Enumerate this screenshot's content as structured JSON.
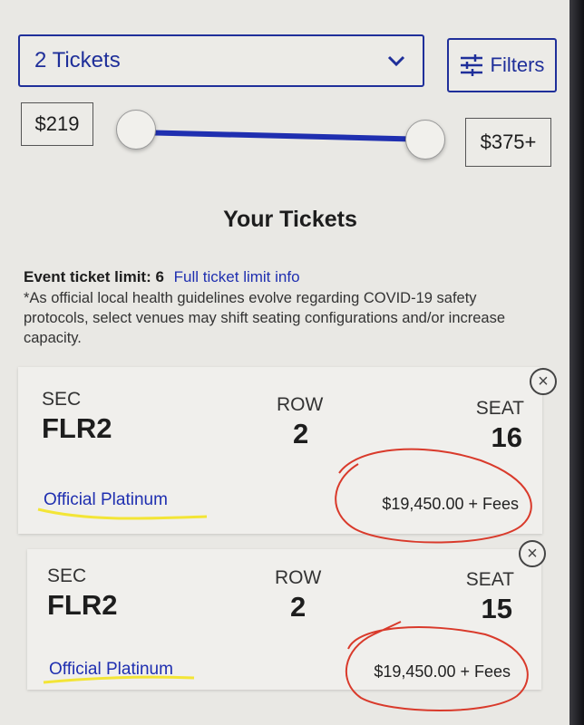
{
  "quantity": {
    "selected": "2 Tickets"
  },
  "filters": {
    "label": "Filters"
  },
  "price_range": {
    "min_label": "$219",
    "max_label": "$375+"
  },
  "section": {
    "title": "Your Tickets"
  },
  "limit": {
    "label": "Event ticket limit: 6",
    "link": "Full ticket limit info",
    "disclaimer": "*As official local health guidelines evolve regarding COVID-19 safety protocols, select venues may shift seating configurations and/or increase capacity."
  },
  "tickets": [
    {
      "sec_label": "SEC",
      "sec": "FLR2",
      "row_label": "ROW",
      "row": "2",
      "seat_label": "SEAT",
      "seat": "16",
      "tier": "Official Platinum",
      "price": "$19,450.00 + Fees"
    },
    {
      "sec_label": "SEC",
      "sec": "FLR2",
      "row_label": "ROW",
      "row": "2",
      "seat_label": "SEAT",
      "seat": "15",
      "tier": "Official Platinum",
      "price": "$19,450.00 + Fees"
    }
  ],
  "icons": {
    "dropdown": "chevron-down-icon",
    "filters": "sliders-icon",
    "remove": "close-icon"
  },
  "colors": {
    "accent": "#1f2fb0",
    "annotation_red": "#d93a2b",
    "annotation_yellow": "#f3e536"
  }
}
